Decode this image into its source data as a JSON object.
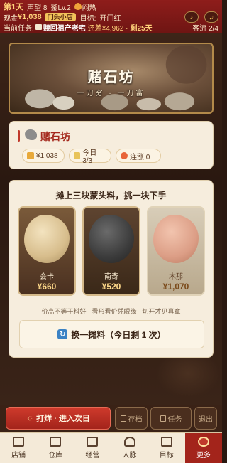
{
  "status": {
    "day": "第1天",
    "reputation": "声望 8",
    "appraisal": "鉴Lv.2",
    "mood": "闷热",
    "cash_label": "现金",
    "cash_value": "¥1,038",
    "shop_tag": "门头小店",
    "goal_label": "目标:",
    "goal_value": "开门红",
    "task_label": "当前任务:",
    "task_name": "赎回祖产老宅",
    "task_need": "还差¥4,962 ·",
    "task_days": "剩25天",
    "visitors": "客流 2/4",
    "icons": [
      "sound-icon",
      "music-icon"
    ]
  },
  "banner": {
    "title": "赌石坊",
    "subtitle": "一刀穷 · 一刀富"
  },
  "info": {
    "title": "赌石坊",
    "cash_chip": "¥1,038",
    "today_chip": "今日 3/3",
    "streak_chip": "连涨 0"
  },
  "panel": {
    "title": "摊上三块蒙头料，挑一块下手",
    "stones": [
      {
        "name": "会卡",
        "price": "¥660",
        "color": "#d7bd8c"
      },
      {
        "name": "南奇",
        "price": "¥520",
        "color": "#3c3c3c"
      },
      {
        "name": "木那",
        "price": "¥1,070",
        "color": "#dc9e86"
      }
    ],
    "hint": "价高不等于料好 · 看形看价凭眼缘 · 切开才见真章",
    "refresh_label": "换一摊料（今日剩 1 次）"
  },
  "actions": {
    "main": "打烊 · 进入次日",
    "save": "存档",
    "task": "任务",
    "exit": "退出"
  },
  "nav": {
    "items": [
      {
        "label": "店铺",
        "icon": "shop-icon"
      },
      {
        "label": "仓库",
        "icon": "warehouse-icon"
      },
      {
        "label": "经营",
        "icon": "business-icon"
      },
      {
        "label": "人脉",
        "icon": "people-icon"
      },
      {
        "label": "目标",
        "icon": "goal-icon"
      },
      {
        "label": "更多",
        "icon": "more-icon"
      }
    ]
  },
  "colors": {
    "accent_red": "#a3241b",
    "gold": "#ffd27a",
    "panel_bg": "#f6eddd"
  }
}
